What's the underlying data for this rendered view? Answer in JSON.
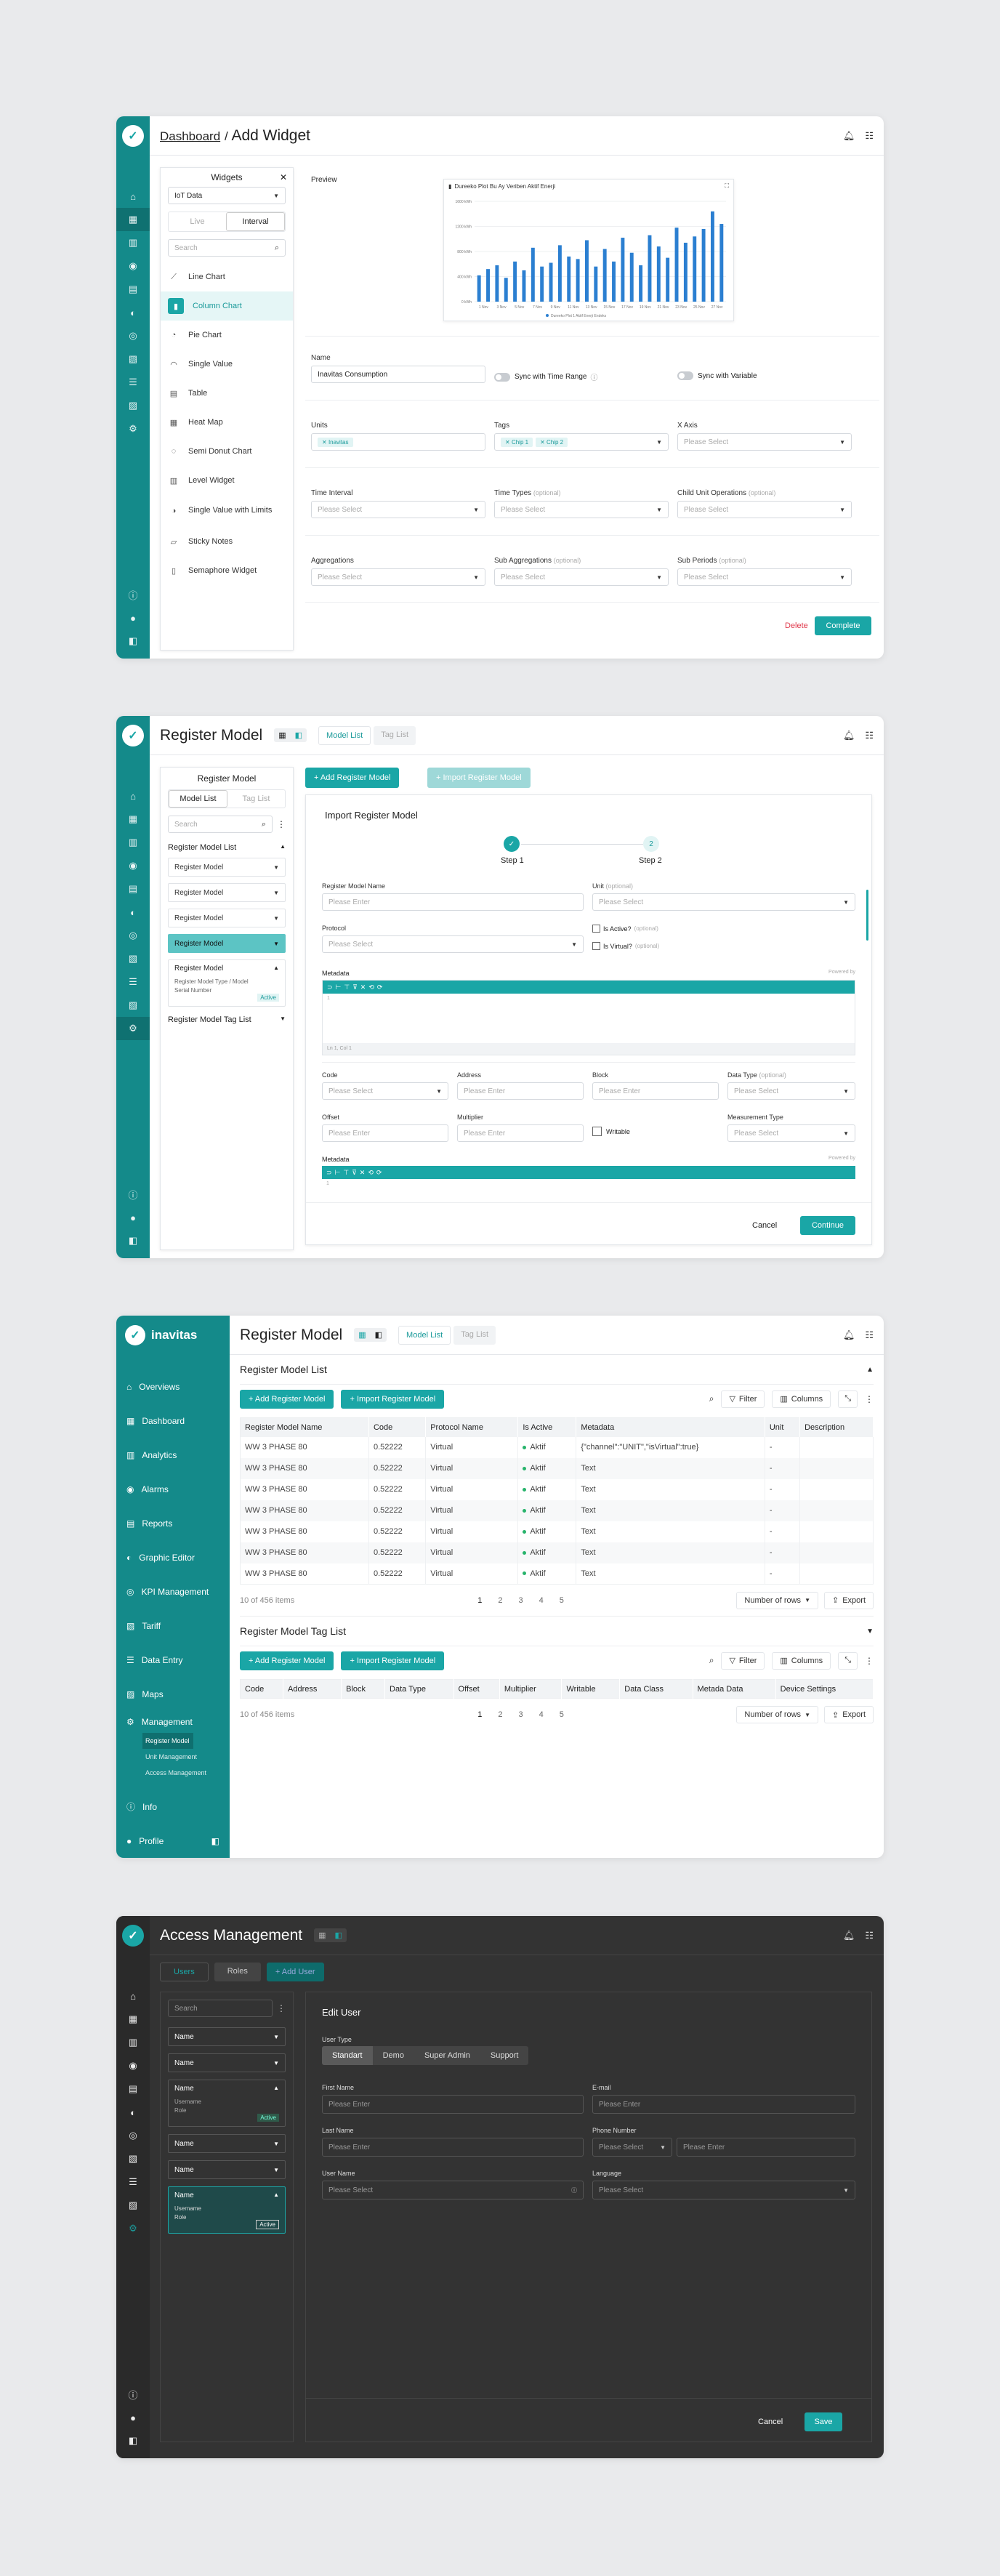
{
  "w1": {
    "breadcrumb_root": "Dashboard",
    "breadcrumb_sep": "/",
    "title": "Add Widget",
    "widgets_panel": {
      "title": "Widgets",
      "source_select": "IoT Data",
      "tabs": [
        "Live",
        "Interval"
      ],
      "search_placeholder": "Search",
      "items": [
        "Line Chart",
        "Column Chart",
        "Pie Chart",
        "Single Value",
        "Table",
        "Heat Map",
        "Semi Donut Chart",
        "Level Widget",
        "Single Value with Limits",
        "Sticky Notes",
        "Semaphore Widget"
      ]
    },
    "preview_label": "Preview",
    "chart_title": "Dureeko Plot Bu Ay Veriben Aktif Enerji",
    "chart_legend": "Dureeko Plot 1 Aktif Enerji Endeks",
    "chart_yticks": [
      "1600 kWh",
      "1200 kWh",
      "800 kWh",
      "400 kWh",
      "0 kWh"
    ],
    "chart_xticks": [
      "1 Nov",
      "3 Nov",
      "5 Nov",
      "7 Nov",
      "9 Nov",
      "11 Nov",
      "13 Nov",
      "15 Nov",
      "17 Nov",
      "19 Nov",
      "21 Nov",
      "23 Nov",
      "25 Nov",
      "27 Nov"
    ],
    "name_label": "Name",
    "name_value": "Inavitas Consumption",
    "sync_time": "Sync with Time Range",
    "sync_var": "Sync with Variable",
    "units_label": "Units",
    "units_chip": "Inavitas",
    "tags_label": "Tags",
    "tags_chips": [
      "Chip 1",
      "Chip 2"
    ],
    "xaxis_label": "X Axis",
    "please_select": "Please Select",
    "time_interval": "Time Interval",
    "time_types": "Time Types",
    "child_ops": "Child Unit Operations",
    "optional": "(optional)",
    "aggregations": "Aggregations",
    "sub_aggregations": "Sub Aggregations",
    "sub_periods": "Sub Periods",
    "delete": "Delete",
    "complete": "Complete"
  },
  "w2": {
    "title": "Register Model",
    "tabs": [
      "Model List",
      "Tag List"
    ],
    "tree_title": "Register Model",
    "tree_tabs": [
      "Model List",
      "Tag List"
    ],
    "search_placeholder": "Search",
    "list_title": "Register Model List",
    "items": [
      "Register Model",
      "Register Model",
      "Register Model",
      "Register Model"
    ],
    "expanded": "Register Model",
    "expanded_line1": "Register Model Type / Model",
    "expanded_line2": "Serial Number",
    "active": "Active",
    "tag_list_title": "Register Model Tag List",
    "add_btn": "+ Add Register Model",
    "import_btn": "+ Import Register Model",
    "form_title": "Import Register Model",
    "step1": "Step 1",
    "step2": "Step 2",
    "step2_num": "2",
    "name_label": "Register Model  Name",
    "unit_label": "Unit",
    "optional": "(optional)",
    "please_enter": "Please Enter",
    "please_select": "Please Select",
    "protocol_label": "Protocol",
    "is_active": "Is Active?",
    "is_virtual": "Is Virtual?",
    "metadata": "Metadata",
    "powered_by": "Powered by",
    "ln": "Ln 1, Col 1",
    "code": "Code",
    "address": "Address",
    "block": "Block",
    "data_type": "Data Type",
    "offset": "Offset",
    "multiplier": "Multiplier",
    "writable": "Writable",
    "measurement_type": "Measurement Type",
    "cancel": "Cancel",
    "continue": "Continue"
  },
  "w3": {
    "brand": "inavitas",
    "title": "Register Model",
    "tabs": [
      "Model List",
      "Tag List"
    ],
    "nav": [
      "Overviews",
      "Dashboard",
      "Analytics",
      "Alarms",
      "Reports",
      "Graphic Editor",
      "KPI Management",
      "Tariff",
      "Data Entry",
      "Maps",
      "Management"
    ],
    "subnav": [
      "Register Model",
      "Unit Management",
      "Access Management"
    ],
    "info": "Info",
    "profile": "Profile",
    "section1": "Register Model List",
    "add_btn": "+ Add Register  Model",
    "import_btn": "+ Import Register Model",
    "filter": "Filter",
    "columns": "Columns",
    "headers": [
      "Register Model Name",
      "Code",
      "Protocol Name",
      "Is Active",
      "Metadata",
      "Unit",
      "Description"
    ],
    "rows": [
      [
        "WW 3 PHASE 80",
        "0.52222",
        "Virtual",
        "Aktif",
        "{\"channel\":\"UNIT\",\"isVirtual\":true}",
        "-",
        ""
      ],
      [
        "WW 3 PHASE 80",
        "0.52222",
        "Virtual",
        "Aktif",
        "Text",
        "-",
        ""
      ],
      [
        "WW 3 PHASE 80",
        "0.52222",
        "Virtual",
        "Aktif",
        "Text",
        "-",
        ""
      ],
      [
        "WW 3 PHASE 80",
        "0.52222",
        "Virtual",
        "Aktif",
        "Text",
        "-",
        ""
      ],
      [
        "WW 3 PHASE 80",
        "0.52222",
        "Virtual",
        "Aktif",
        "Text",
        "-",
        ""
      ],
      [
        "WW 3 PHASE 80",
        "0.52222",
        "Virtual",
        "Aktif",
        "Text",
        "-",
        ""
      ],
      [
        "WW 3 PHASE 80",
        "0.52222",
        "Virtual",
        "Aktif",
        "Text",
        "-",
        ""
      ]
    ],
    "count": "10 of 456 items",
    "pages": [
      "1",
      "2",
      "3",
      "4",
      "5"
    ],
    "rows_select": "Number of rows",
    "export": "Export",
    "section2": "Register Model Tag List",
    "headers2": [
      "Code",
      "Address",
      "Block",
      "Data Type",
      "Offset",
      "Multiplier",
      "Writable",
      "Data Class",
      "Metada Data",
      "Device Settings"
    ]
  },
  "w4": {
    "title": "Access Management",
    "tabs": [
      "Users",
      "Roles"
    ],
    "add_user": "+ Add User",
    "search_placeholder": "Search",
    "name": "Name",
    "username": "Username",
    "role": "Role",
    "active": "Active",
    "edit_title": "Edit User",
    "user_type": "User Type",
    "types": [
      "Standart",
      "Demo",
      "Super Admin",
      "Support"
    ],
    "first_name": "First Name",
    "email": "E-mail",
    "last_name": "Last Name",
    "phone": "Phone Number",
    "user_name": "User Name",
    "language": "Language",
    "please_enter": "Please Enter",
    "please_select": "Please Select",
    "cancel": "Cancel",
    "save": "Save"
  },
  "chart_data": {
    "type": "bar",
    "title": "Dureeko Plot Bu Ay Veriben Aktif Enerji",
    "ylim": [
      0,
      1600
    ],
    "values": [
      420,
      520,
      580,
      380,
      640,
      500,
      860,
      560,
      620,
      900,
      720,
      680,
      980,
      560,
      840,
      640,
      1020,
      780,
      580,
      1060,
      880,
      700,
      1180,
      940,
      1040,
      1160,
      1440,
      1240
    ]
  },
  "colors": {
    "accent": "#1aa6a6",
    "rail": "#148a8a",
    "danger": "#e0384b",
    "dark_bg": "#333333"
  }
}
